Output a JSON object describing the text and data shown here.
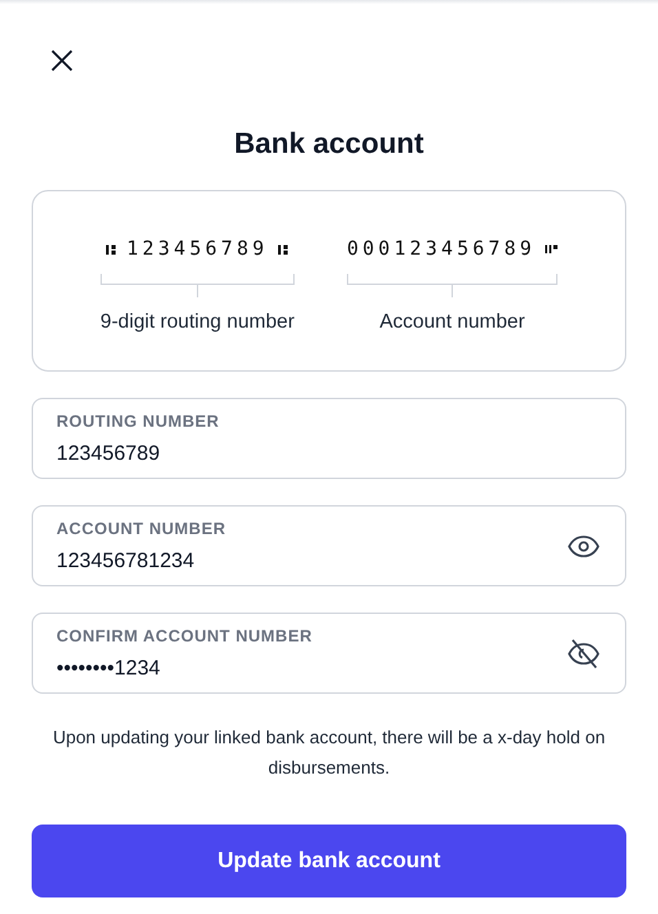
{
  "title": "Bank account",
  "check_diagram": {
    "segments": [
      {
        "digits": "123456789",
        "label": "9-digit routing number",
        "kind": "routing"
      },
      {
        "digits": "000123456789",
        "label": "Account number",
        "kind": "account"
      }
    ]
  },
  "fields": [
    {
      "label": "ROUTING NUMBER",
      "value": "123456789",
      "kind": "plain"
    },
    {
      "label": "ACCOUNT NUMBER",
      "value": "123456781234",
      "kind": "secret",
      "visible": true
    },
    {
      "label": "CONFIRM ACCOUNT NUMBER",
      "value": "••••••••1234",
      "kind": "secret",
      "visible": false
    }
  ],
  "note": "Upon updating your linked bank account, there will be a x-day hold on disbursements.",
  "button": "Update bank account"
}
